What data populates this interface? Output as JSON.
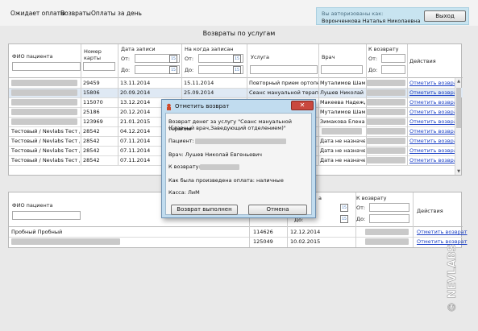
{
  "menu": {
    "items": [
      "Ожидает оплаты",
      "Возвраты",
      "Оплаты за день"
    ]
  },
  "auth": {
    "label": "Вы авторизованы как:",
    "user": "Воронченкова Наталья Николаевна",
    "logout_label": "Выход"
  },
  "page": {
    "title": "Возвраты по услугам"
  },
  "table1": {
    "headers": {
      "fio": "ФИО пациента",
      "card": "Номер карты",
      "record_date": "Дата записи",
      "when_recorded": "На когда записан",
      "service": "Услуга",
      "doctor": "Врач",
      "to_return": "К возврату",
      "actions": "Действия",
      "from": "От:",
      "to": "До:"
    },
    "rows": [
      {
        "fio": "",
        "card": "29459",
        "record_date": "13.11.2014",
        "when": "15.11.2014",
        "service": "Повторный прием ортопе",
        "doctor": "Муталимов Шам",
        "action": "Отметить возврат"
      },
      {
        "fio": "",
        "card": "15806",
        "record_date": "20.09.2014",
        "when": "25.09.2014",
        "service": "Сеанс мануальной терапи",
        "doctor": "Лушев Николай Е",
        "action": "Отметить возврат"
      },
      {
        "fio": "",
        "card": "115070",
        "record_date": "13.12.2014",
        "when": "",
        "service": "",
        "doctor": "Макеева Надежд",
        "action": "Отметить возврат"
      },
      {
        "fio": "",
        "card": "25186",
        "record_date": "20.12.2014",
        "when": "",
        "service": "",
        "doctor": "Муталимов Шам",
        "action": "Отметить возврат"
      },
      {
        "fio": "",
        "card": "123969",
        "record_date": "21.01.2015",
        "when": "",
        "service": "",
        "doctor": "Зимакова Елена",
        "action": "Отметить возврат"
      },
      {
        "fio": "Тестовый / Nevlabs Тест / I",
        "card": "28542",
        "record_date": "04.12.2014",
        "when": "",
        "service": "",
        "doctor": "",
        "action": "Отметить возврат"
      },
      {
        "fio": "Тестовый / Nevlabs Тест / I",
        "card": "28542",
        "record_date": "07.11.2014",
        "when": "",
        "service": "",
        "doctor": "Дата не назначен",
        "action": "Отметить возврат"
      },
      {
        "fio": "Тестовый / Nevlabs Тест / I",
        "card": "28542",
        "record_date": "07.11.2014",
        "when": "",
        "service": "",
        "doctor": "Дата не назначен",
        "action": "Отметить возврат"
      },
      {
        "fio": "Тестовый / Nevlabs Тест / I",
        "card": "28542",
        "record_date": "07.11.2014",
        "when": "",
        "service": "",
        "doctor": "Дата не назначен",
        "action": "Отметить возврат"
      }
    ]
  },
  "table2": {
    "headers": {
      "fio": "ФИО пациента",
      "to_return": "К возврату",
      "actions": "Действия",
      "from": "От:",
      "to": "До:",
      "partial": "а"
    },
    "rows": [
      {
        "fio": "Пробный Пробный",
        "card": "114626",
        "date": "12.12.2014",
        "action": "Отметить возврат"
      },
      {
        "fio": "",
        "card": "125049",
        "date": "10.02.2015",
        "action": "Отметить возврат"
      }
    ]
  },
  "dialog": {
    "title": "Отметить возврат",
    "line1": "Возврат денег за услугу \"Сеанс мануальной терапии",
    "line2": "(Главный врач,Заведующий отделением)\"",
    "patient_label": "Пациент:",
    "doctor_line": "Врач: Лушев Николай Евгеньевич",
    "to_return_label": "К возврату:",
    "payment_line": "Как была произведена оплата: наличные",
    "cashbox_line": "Касса: ЛиМ",
    "done_label": "Возврат выполнен",
    "cancel_label": "Отмена"
  },
  "watermark": {
    "text": "© NEVLABS"
  },
  "colors": {
    "link": "#1a3fc4",
    "auth_bg": "#c8e4f0",
    "dialog_frame": "#c1dcef",
    "close_button": "#c9483e"
  }
}
